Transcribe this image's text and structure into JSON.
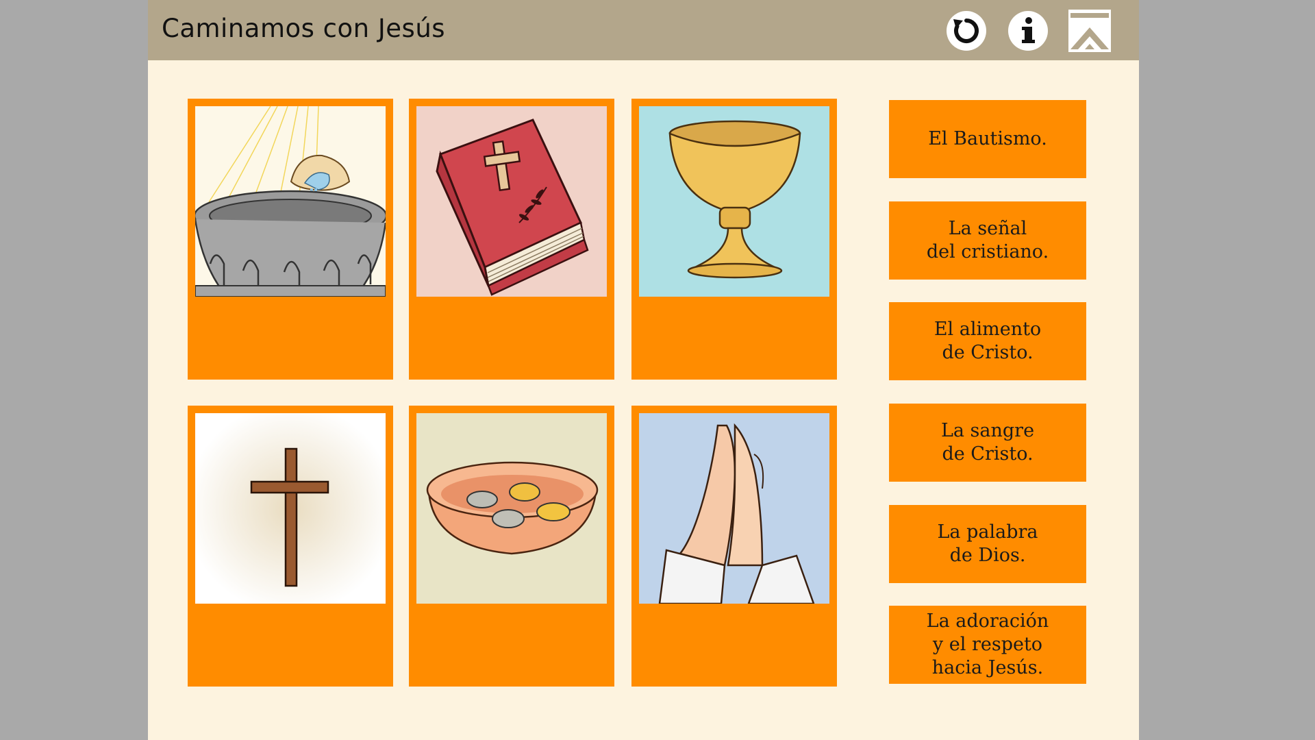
{
  "header": {
    "title": "Caminamos con Jesús"
  },
  "toolbar": {
    "restart_icon": "restart-icon",
    "info_icon": "info-icon",
    "home_icon": "home-icon"
  },
  "cards": [
    {
      "name": "card-baptismal-font",
      "icon": "baptismal-font-image"
    },
    {
      "name": "card-bible",
      "icon": "bible-image"
    },
    {
      "name": "card-chalice",
      "icon": "chalice-image"
    },
    {
      "name": "card-cross",
      "icon": "cross-image"
    },
    {
      "name": "card-offering-bowl",
      "icon": "offering-bowl-image"
    },
    {
      "name": "card-praying-hands",
      "icon": "praying-hands-image"
    }
  ],
  "labels": [
    "El Bautismo.",
    "La señal\ndel cristiano.",
    "El alimento\nde Cristo.",
    "La sangre\nde Cristo.",
    "La palabra\nde Dios.",
    "La adoración\ny el respeto\nhacia Jesús."
  ],
  "colors": {
    "titlebar": "#b3a68b",
    "background": "#fdf3df",
    "accent": "#ff8c00"
  }
}
